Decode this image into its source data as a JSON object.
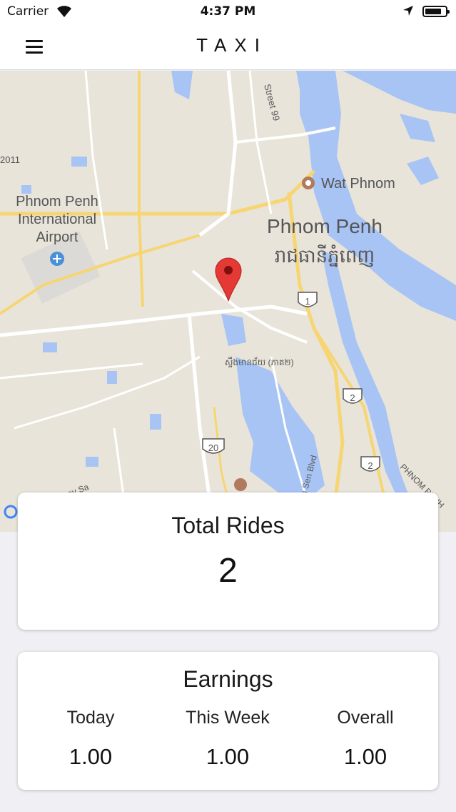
{
  "status_bar": {
    "carrier": "Carrier",
    "time": "4:37 PM",
    "icons": [
      "wifi-icon",
      "location-arrow-icon",
      "battery-icon"
    ]
  },
  "nav": {
    "title": "TAXI",
    "menu_icon": "hamburger-menu-icon"
  },
  "map": {
    "labels": {
      "street": "Street 99",
      "road_code": "2011",
      "airport_line1": "Phnom Penh",
      "airport_line2": "International",
      "airport_line3": "Airport",
      "wat_phnom": "Wat Phnom",
      "city": "Phnom Penh",
      "city_khmer": "រាជធានីភ្នំពេញ",
      "district_khmer": "ស្ទឹងមានជ័យ (ភាគ២)",
      "blvd": "Hun Sen Blvd",
      "prey_sa": "Prey Sa",
      "phnom_penh_corner": "PHNOM PENH",
      "route_1": "1",
      "route_2a": "2",
      "route_2b": "2",
      "route_20": "20"
    },
    "colors": {
      "land": "#e8e4da",
      "water": "#a8c4f5",
      "road": "#ffffff",
      "highway": "#f6d572",
      "pin": "#e53935"
    }
  },
  "rides": {
    "title": "Total Rides",
    "value": "2"
  },
  "earnings": {
    "title": "Earnings",
    "columns": [
      {
        "label": "Today",
        "value": "1.00"
      },
      {
        "label": "This Week",
        "value": "1.00"
      },
      {
        "label": "Overall",
        "value": "1.00"
      }
    ]
  }
}
